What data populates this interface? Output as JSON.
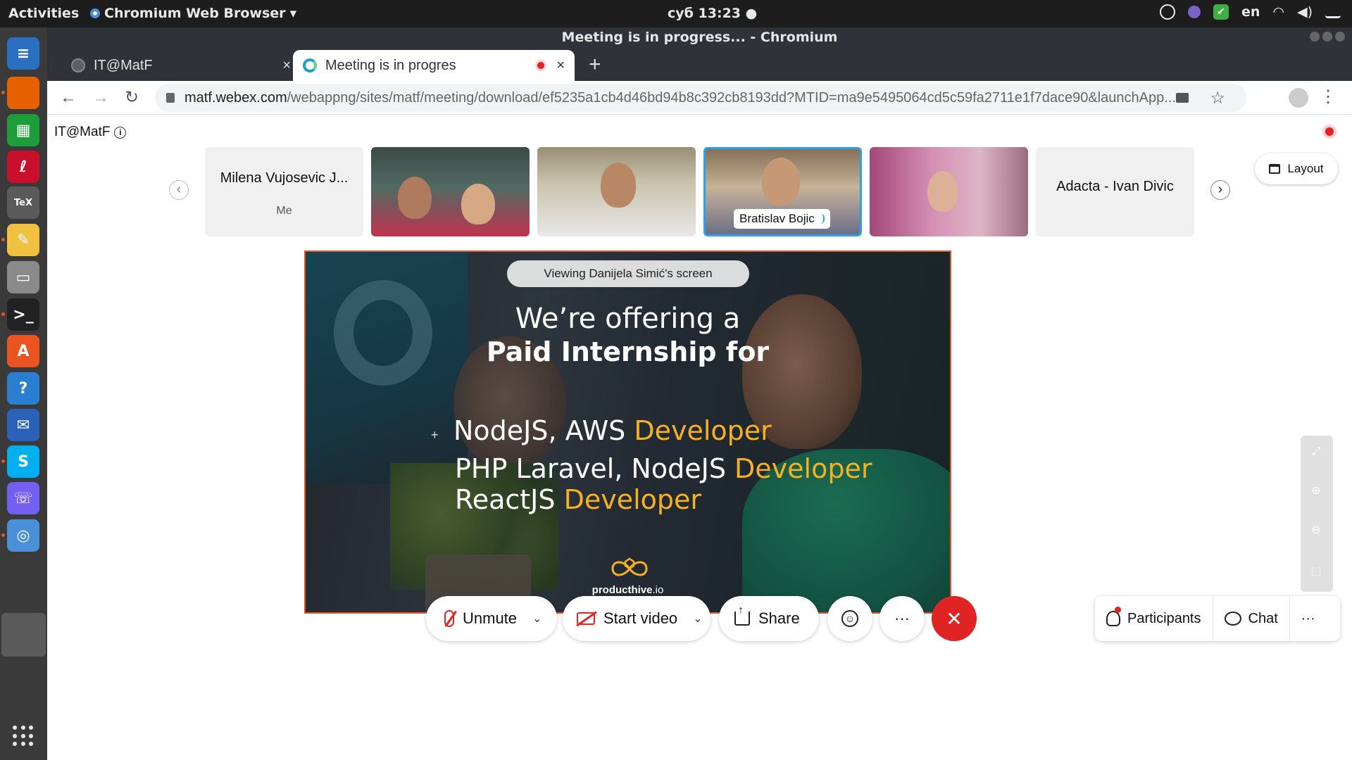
{
  "os": {
    "activities": "Activities",
    "app_menu": "Chromium Web Browser",
    "clock": "суб 13:23",
    "lang": "en"
  },
  "dock": {
    "items": [
      {
        "name": "libreoffice-writer-icon",
        "glyph": "≡",
        "color": "#2a6fc0"
      },
      {
        "name": "firefox-icon",
        "glyph": "",
        "color": "#e66000"
      },
      {
        "name": "libreoffice-calc-icon",
        "glyph": "▦",
        "color": "#1e9e3b"
      },
      {
        "name": "evince-icon",
        "glyph": "ℓ",
        "color": "#c8102e"
      },
      {
        "name": "texmaker-icon",
        "glyph": "TeX",
        "color": "#5a5a5a"
      },
      {
        "name": "text-editor-icon",
        "glyph": "✎",
        "color": "#f0c040"
      },
      {
        "name": "files-icon",
        "glyph": "▭",
        "color": "#8a8a8a"
      },
      {
        "name": "terminal-icon",
        "glyph": ">_",
        "color": "#222222"
      },
      {
        "name": "software-center-icon",
        "glyph": "A",
        "color": "#e95420"
      },
      {
        "name": "help-icon",
        "glyph": "?",
        "color": "#2a7fd0"
      },
      {
        "name": "thunderbird-icon",
        "glyph": "✉",
        "color": "#2b62b8"
      },
      {
        "name": "skype-icon",
        "glyph": "S",
        "color": "#00aff0"
      },
      {
        "name": "viber-icon",
        "glyph": "☏",
        "color": "#7360f2"
      },
      {
        "name": "chromium-icon",
        "glyph": "◎",
        "color": "#4a90d9"
      }
    ]
  },
  "window": {
    "title": "Meeting is in progress... - Chromium"
  },
  "tabs": [
    {
      "label": "IT@MatF",
      "close": "×"
    },
    {
      "label": "Meeting is in progres",
      "close": "×"
    }
  ],
  "new_tab": "+",
  "toolbar": {
    "back": "←",
    "forward": "→",
    "reload": "↻",
    "url_host": "matf.webex.com",
    "url_path": "/webappng/sites/matf/meeting/download/ef5235a1cb4d46bd94b8c392cb8193dd?MTID=ma9e5495064cd5c59fa2711e1f7dace90&launchApp...",
    "star": "☆",
    "menu": "⋮"
  },
  "page": {
    "site_name": "IT@MatF",
    "info": "i",
    "layout_label": "Layout"
  },
  "participants": [
    {
      "name": "Milena Vujosevic J...",
      "sub": "Me"
    },
    {
      "name": "Bratislav Bojic"
    },
    {
      "name": "Adacta - Ivan Divic"
    }
  ],
  "share": {
    "viewing": "Viewing Danijela Simić's screen",
    "line1": "We’re offering a",
    "line2": "Paid Internship for",
    "roles": [
      {
        "tech": "NodeJS, AWS ",
        "title": "Developer"
      },
      {
        "tech": "PHP Laravel, NodeJS ",
        "title": "Developer"
      },
      {
        "tech": "ReactJS ",
        "title": "Developer"
      }
    ],
    "brand_bold": "producthive",
    "brand_light": ".io"
  },
  "controls": {
    "unmute": "Unmute",
    "start_video": "Start video",
    "share": "Share",
    "more": "···",
    "leave": "✕",
    "participants": "Participants",
    "chat": "Chat",
    "more_right": "···"
  },
  "colors": {
    "accent": "#f5b120",
    "recording": "#e02424",
    "active_speaker": "#2aa1e8"
  }
}
